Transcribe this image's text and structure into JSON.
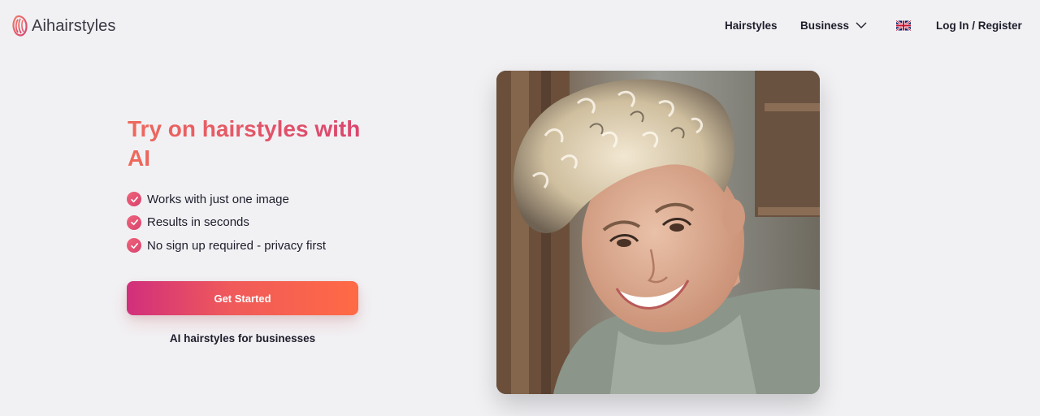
{
  "header": {
    "logo_text": "Aihairstyles",
    "nav": {
      "hairstyles": "Hairstyles",
      "business": "Business",
      "login": "Log In / Register"
    },
    "language_flag": "uk-flag-icon"
  },
  "hero": {
    "title": "Try on hairstyles with AI",
    "features": [
      "Works with just one image",
      "Results in seconds",
      "No sign up required - privacy first"
    ],
    "cta_label": "Get Started",
    "business_link": "AI hairstyles for businesses"
  },
  "colors": {
    "background": "#f1f1f4",
    "accent_start": "#d12f7c",
    "accent_end": "#ff6a45",
    "title_gradient": "#ee6a5c"
  }
}
